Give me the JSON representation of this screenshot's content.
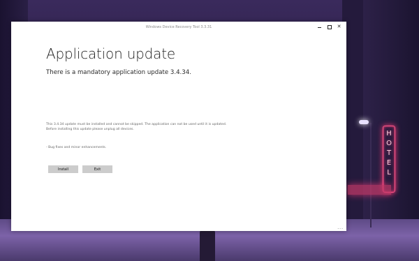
{
  "window": {
    "title": "Windows Device Recovery Tool 3.3.31",
    "controls": [
      "minimize",
      "maximize",
      "close"
    ],
    "close_glyph": "✕"
  },
  "main": {
    "heading": "Application update",
    "subheading": "There is a mandatory application update 3.4.34.",
    "details_line1": "This 3.4.34 update must be installed and cannot be skipped. The application can not be used until it is updated.",
    "details_line2": "Before installing this update please unplug all devices.",
    "bullet": "- Bug fixes and minor enhancements."
  },
  "buttons": {
    "install": "Install",
    "exit": "Exit"
  },
  "footer": {
    "more": "..."
  },
  "background": {
    "neon_sign": [
      "H",
      "O",
      "T",
      "E",
      "L"
    ]
  },
  "colors": {
    "window_bg": "#ffffff",
    "button_bg": "#cccccc",
    "neon": "#ff3b7a"
  }
}
